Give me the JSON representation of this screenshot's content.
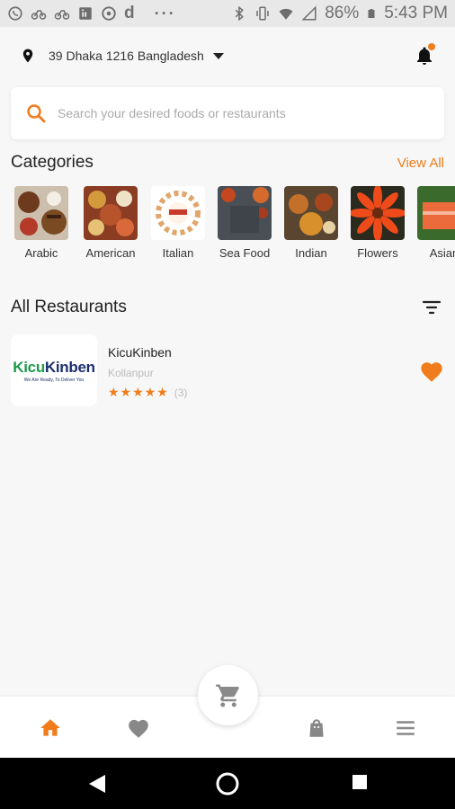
{
  "status_bar": {
    "battery": "86%",
    "time": "5:43 PM"
  },
  "location": {
    "address": "39 Dhaka 1216 Bangladesh"
  },
  "search": {
    "placeholder": "Search your desired foods or restaurants"
  },
  "categories": {
    "title": "Categories",
    "view_all": "View All",
    "items": [
      {
        "label": "Arabic"
      },
      {
        "label": "American"
      },
      {
        "label": "Italian"
      },
      {
        "label": "Sea Food"
      },
      {
        "label": "Indian"
      },
      {
        "label": "Flowers"
      },
      {
        "label": "Asian"
      }
    ]
  },
  "restaurants": {
    "title": "All Restaurants",
    "items": [
      {
        "name": "KicuKinben",
        "location": "Kollanpur",
        "stars": "★★★★★",
        "review_count": "(3)",
        "logo_text_1": "Kicu",
        "logo_text_2": "Kinben",
        "logo_tagline": "We Are Ready, To Deliver You"
      }
    ]
  },
  "colors": {
    "accent": "#f07c1b",
    "background": "#f7f7f7"
  },
  "icons": {
    "location": "location-pin-icon",
    "notification": "bell-icon",
    "search": "search-icon",
    "filter": "filter-icon",
    "favorite": "heart-icon",
    "home": "home-icon",
    "wishlist": "heart-icon",
    "cart": "cart-icon",
    "orders": "bag-icon",
    "menu": "menu-icon"
  }
}
